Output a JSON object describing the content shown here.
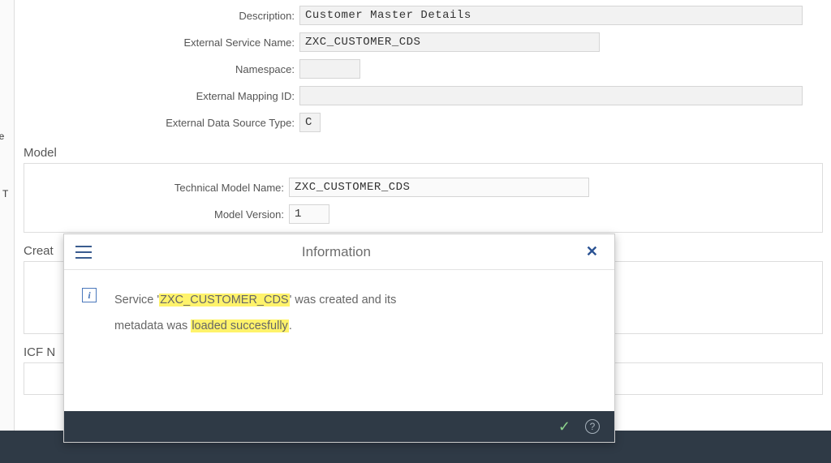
{
  "sidebar": {
    "fragment1": "le",
    "fragment2": "T"
  },
  "form": {
    "description": {
      "label": "Description:",
      "value": "Customer Master Details"
    },
    "ext_service_name": {
      "label": "External Service Name:",
      "value": "ZXC_CUSTOMER_CDS"
    },
    "namespace": {
      "label": "Namespace:",
      "value": ""
    },
    "ext_mapping_id": {
      "label": "External Mapping ID:",
      "value": ""
    },
    "ext_data_src_type": {
      "label": "External Data Source Type:",
      "value": "C"
    }
  },
  "model": {
    "title": "Model",
    "tech_model_name": {
      "label": "Technical Model Name:",
      "value": "ZXC_CUSTOMER_CDS"
    },
    "model_version": {
      "label": "Model Version:",
      "value": "1"
    }
  },
  "sections": {
    "creation_title_visible": "Creat",
    "icf_title_visible": "ICF N"
  },
  "dialog": {
    "title": "Information",
    "msg_part1": "Service '",
    "msg_hl1": "ZXC_CUSTOMER_CDS",
    "msg_part2": "' was created and its",
    "msg_part3": "metadata was ",
    "msg_hl2": "loaded succesfully",
    "msg_part4": "."
  }
}
